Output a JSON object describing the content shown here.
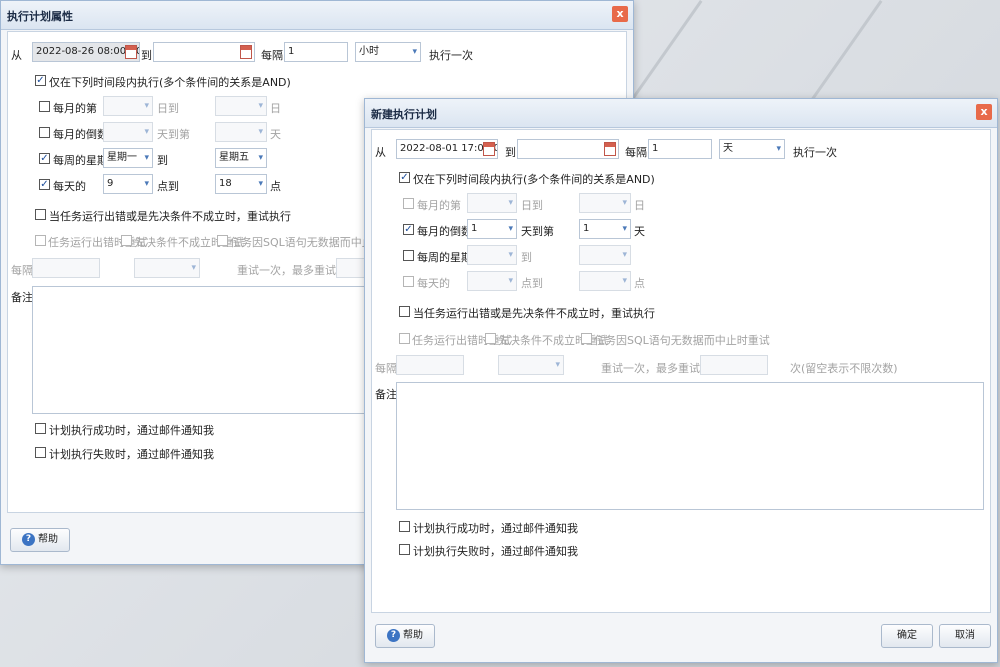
{
  "dialog1": {
    "title": "执行计划属性",
    "close": "x",
    "from_label": "从",
    "from_value": "2022-08-26 08:00:00",
    "to_label": "到",
    "to_value": "",
    "every_label": "每隔",
    "every_value": "1",
    "unit_value": "小时",
    "exec_once": "执行一次",
    "only_period": "仅在下列时间段内执行(多个条件间的关系是AND)",
    "row_monthday": {
      "label": "每月的第",
      "checked": false,
      "mid": "日到",
      "end": "日",
      "v1": "",
      "v2": ""
    },
    "row_monthrev": {
      "label": "每月的倒数第",
      "checked": false,
      "mid": "天到第",
      "end": "天",
      "v1": "",
      "v2": ""
    },
    "row_week": {
      "label": "每周的星期",
      "checked": true,
      "mid": "到",
      "end": "",
      "v1": "星期一",
      "v2": "星期五"
    },
    "row_day": {
      "label": "每天的",
      "checked": true,
      "mid": "点到",
      "end": "点",
      "v1": "9",
      "v2": "18"
    },
    "retry_label": "当任务运行出错或是先决条件不成立时，重试执行",
    "retry_opt1": "任务运行出错时重试",
    "retry_opt2": "先决条件不成立时重试",
    "retry_opt3": "任务因SQL语句无数据而中止时重试",
    "interval_label": "每隔",
    "retry_text": "重试一次，最多重试",
    "notes_label": "备注",
    "notify_success": "计划执行成功时，通过邮件通知我",
    "notify_fail": "计划执行失败时，通过邮件通知我",
    "help": "帮助"
  },
  "dialog2": {
    "title": "新建执行计划",
    "close": "x",
    "from_label": "从",
    "from_value": "2022-08-01 17:00:00",
    "to_label": "到",
    "to_value": "",
    "every_label": "每隔",
    "every_value": "1",
    "unit_value": "天",
    "exec_once": "执行一次",
    "only_period": "仅在下列时间段内执行(多个条件间的关系是AND)",
    "row_monthday": {
      "label": "每月的第",
      "checked": false,
      "mid": "日到",
      "end": "日",
      "v1": "",
      "v2": ""
    },
    "row_monthrev": {
      "label": "每月的倒数第",
      "checked": true,
      "mid": "天到第",
      "end": "天",
      "v1": "1",
      "v2": "1"
    },
    "row_week": {
      "label": "每周的星期",
      "checked": false,
      "mid": "到",
      "end": "",
      "v1": "",
      "v2": ""
    },
    "row_day": {
      "label": "每天的",
      "checked": false,
      "mid": "点到",
      "end": "点",
      "v1": "",
      "v2": ""
    },
    "retry_label": "当任务运行出错或是先决条件不成立时，重试执行",
    "retry_opt1": "任务运行出错时重试",
    "retry_opt2": "先决条件不成立时重试",
    "retry_opt3": "任务因SQL语句无数据而中止时重试",
    "interval_label": "每隔",
    "retry_text": "重试一次，最多重试",
    "retry_suffix": "次(留空表示不限次数)",
    "notes_label": "备注",
    "notify_success": "计划执行成功时，通过邮件通知我",
    "notify_fail": "计划执行失败时，通过邮件通知我",
    "help": "帮助",
    "ok": "确定",
    "cancel": "取消"
  },
  "arrow_glyph": "▾",
  "check_glyph": "✓"
}
